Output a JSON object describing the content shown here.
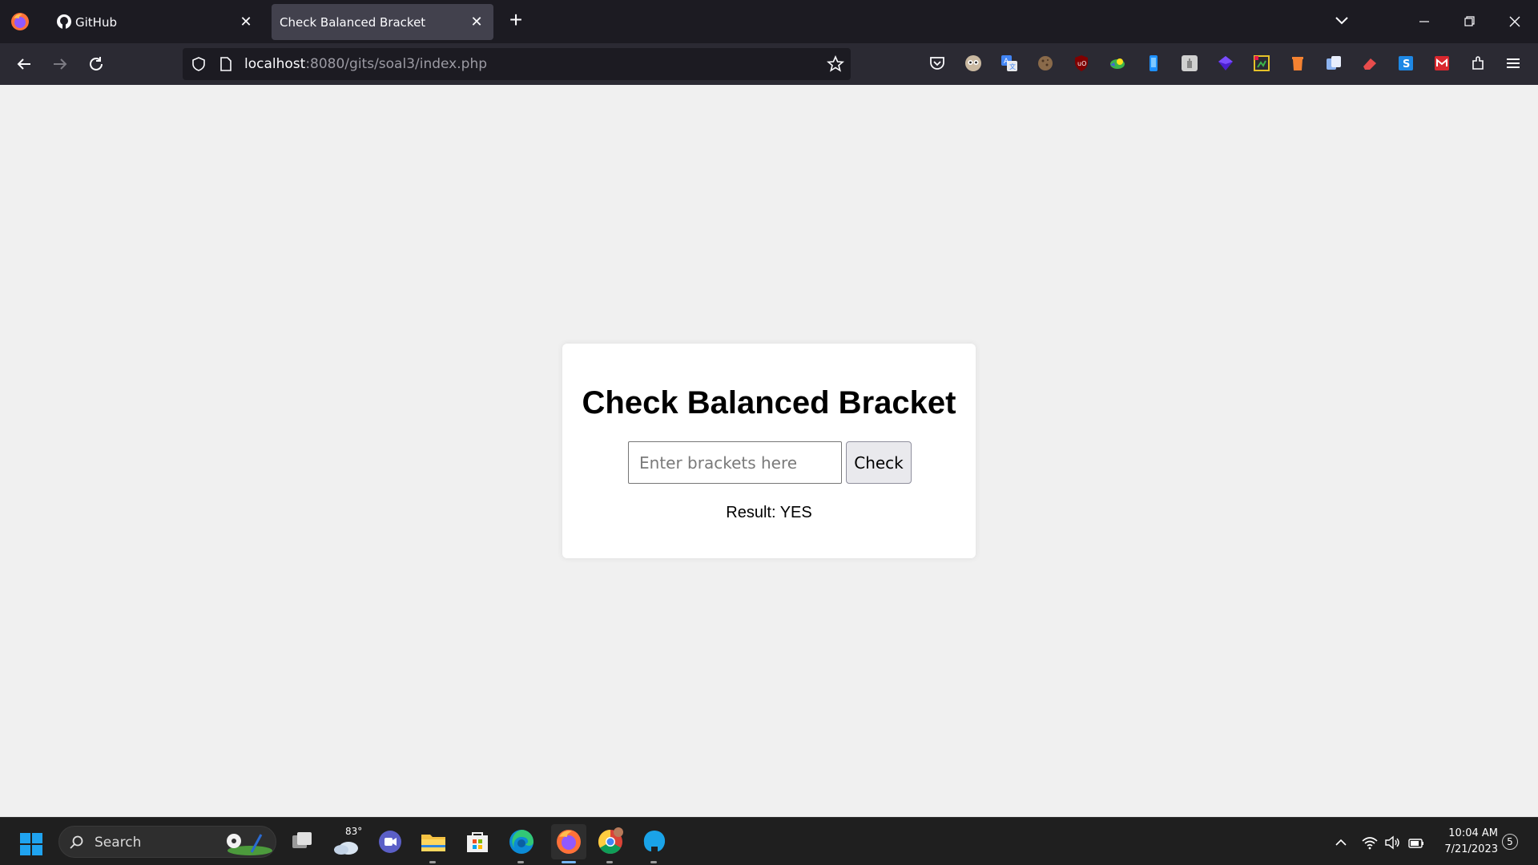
{
  "browser": {
    "tabs": [
      {
        "title": "GitHub",
        "active": false
      },
      {
        "title": "Check Balanced Bracket",
        "active": true
      }
    ],
    "url": {
      "host": "localhost",
      "path": ":8080/gits/soal3/index.php"
    },
    "extensions": [
      "pocket-icon",
      "owl-icon",
      "translate-icon",
      "cookie-icon",
      "ublock-icon",
      "colorful-bird-icon",
      "phone-icon",
      "hand-icon",
      "cube-icon",
      "color-picker-icon",
      "trash-icon",
      "copy-icon",
      "eraser-icon",
      "s-icon",
      "mega-icon",
      "extensions-icon"
    ]
  },
  "page": {
    "heading": "Check Balanced Bracket",
    "input": {
      "value": "",
      "placeholder": "Enter brackets here"
    },
    "check_label": "Check",
    "result_text": "Result: YES"
  },
  "taskbar": {
    "search_label": "Search",
    "weather_temp": "83°",
    "apps": [
      "task-view-icon",
      "weather-icon",
      "teams-icon",
      "file-explorer-icon",
      "store-icon",
      "edge-icon",
      "firefox-icon",
      "chrome-icon",
      "app-icon"
    ],
    "clock": {
      "time": "10:04 AM",
      "date": "7/21/2023"
    },
    "notification_count": "5"
  },
  "colors": {
    "tabbar_bg": "#1c1b22",
    "navbar_bg": "#2b2a33",
    "page_bg": "#f0f0f0",
    "card_bg": "#ffffff",
    "taskbar_bg": "#1f1f1f",
    "accent": "#75b6f3"
  }
}
